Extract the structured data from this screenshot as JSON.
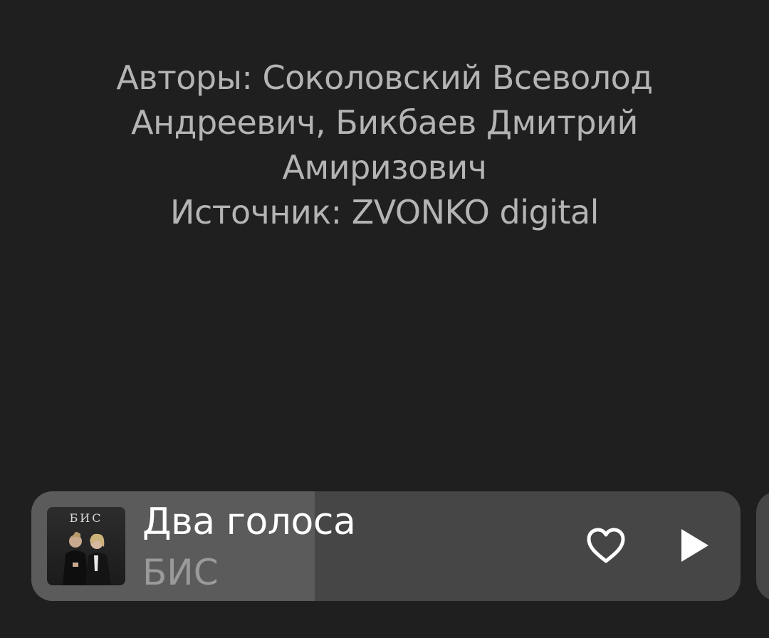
{
  "credits": {
    "lines": [
      "Авторы: Соколовский Всеволод",
      "Андреевич, Бикбаев Дмитрий",
      "Амиризович",
      "Источник: ZVONKO digital"
    ]
  },
  "player": {
    "track_title": "Два голоса",
    "artist": "БИС",
    "cover_text": "БИС",
    "progress_fraction": 0.4,
    "like_icon": "heart-outline-icon",
    "play_icon": "play-icon"
  },
  "colors": {
    "background": "#1f1f1f",
    "card": "#464646",
    "progress": "#5b5b5b",
    "credits_text": "#b4b4b4",
    "title_text": "#ffffff",
    "artist_text": "#9a9a9a"
  }
}
